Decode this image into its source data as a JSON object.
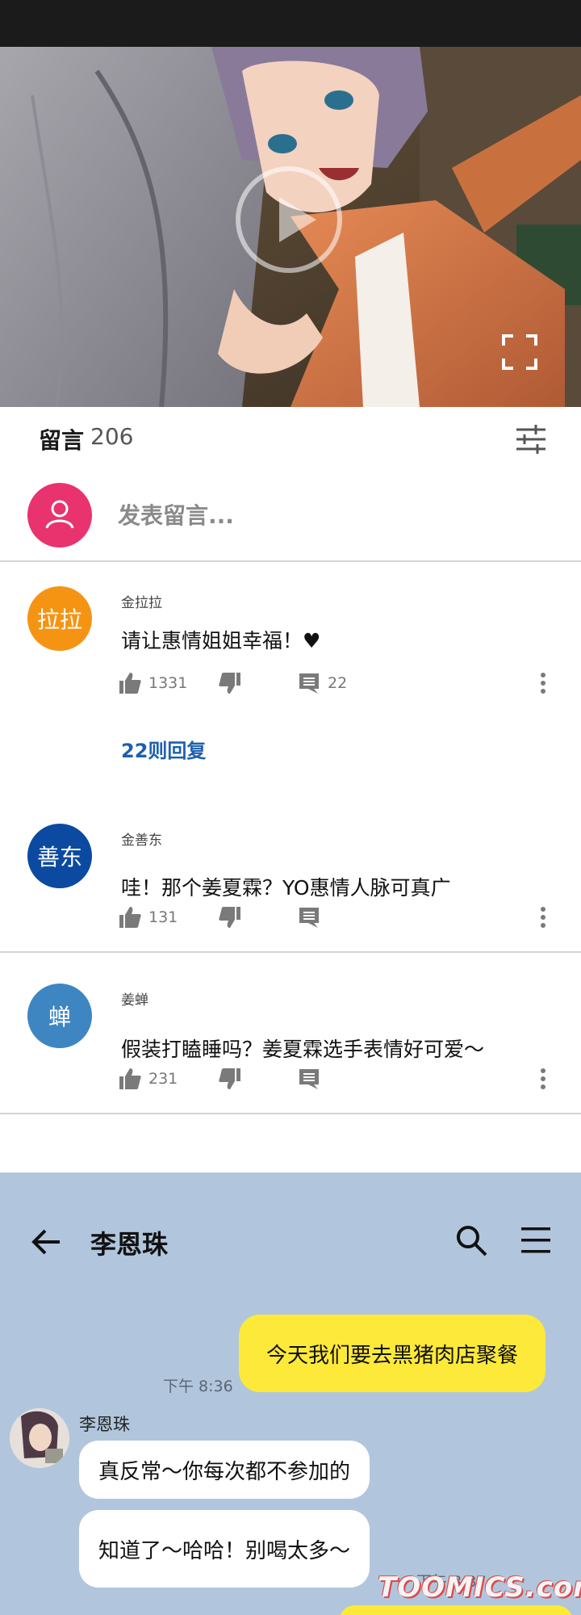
{
  "comments_section": {
    "title": "留言",
    "count": "206",
    "compose_placeholder": "发表留言..."
  },
  "comments": [
    {
      "avatar_text": "拉拉",
      "avatar_color": "#f59412",
      "author": "金拉拉",
      "text": "请让惠情姐姐幸福！♥",
      "likes": "1331",
      "replies": "22",
      "replies_link": "22则回复"
    },
    {
      "avatar_text": "善东",
      "avatar_color": "#0b4aa0",
      "author": "金善东",
      "text": "哇！那个姜夏霖？YO惠情人脉可真广",
      "likes": "131",
      "replies": ""
    },
    {
      "avatar_text": "蝉",
      "avatar_color": "#3e86c2",
      "author": "姜蝉",
      "text": "假装打瞌睡吗？姜夏霖选手表情好可爱～",
      "likes": "231",
      "replies": ""
    }
  ],
  "chat": {
    "contact_name": "李恩珠",
    "messages": [
      {
        "from": "me",
        "text": "今天我们要去黑猪肉店聚餐",
        "time": "下午 8:36"
      },
      {
        "from": "them",
        "sender": "李恩珠",
        "text": "真反常～你每次都不参加的"
      },
      {
        "from": "them",
        "text": "知道了～哈哈！别喝太多～",
        "time": "下午 8:37"
      }
    ]
  },
  "colors": {
    "compose_avatar": "#e8336f",
    "link": "#1d5fae",
    "chat_background": "#b1c6dd",
    "my_bubble": "#fde93a"
  },
  "icons": [
    "play-icon",
    "fullscreen-icon",
    "filter-icon",
    "user-icon",
    "thumb-up-icon",
    "thumb-down-icon",
    "reply-icon",
    "more-vertical-icon",
    "back-arrow-icon",
    "search-icon",
    "menu-icon"
  ],
  "watermark": "TOOMICS.com"
}
